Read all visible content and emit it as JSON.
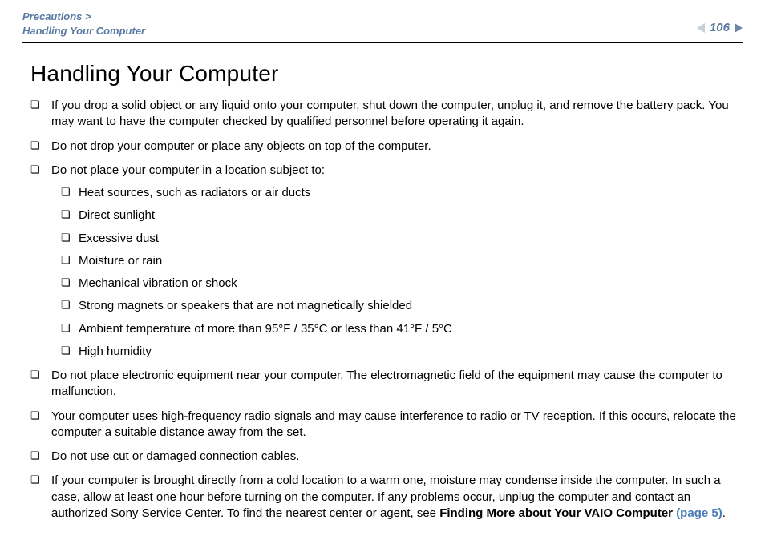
{
  "header": {
    "breadcrumb_section": "Precautions >",
    "breadcrumb_page": "Handling Your Computer",
    "page_number": "106"
  },
  "title": "Handling Your Computer",
  "items": [
    {
      "text": "If you drop a solid object or any liquid onto your computer, shut down the computer, unplug it, and remove the battery pack. You may want to have the computer checked by qualified personnel before operating it again."
    },
    {
      "text": "Do not drop your computer or place any objects on top of the computer."
    },
    {
      "text": "Do not place your computer in a location subject to:",
      "sub": [
        "Heat sources, such as radiators or air ducts",
        "Direct sunlight",
        "Excessive dust",
        "Moisture or rain",
        "Mechanical vibration or shock",
        "Strong magnets or speakers that are not magnetically shielded",
        "Ambient temperature of more than 95°F / 35°C or less than 41°F / 5°C",
        "High humidity"
      ]
    },
    {
      "text": "Do not place electronic equipment near your computer. The electromagnetic field of the equipment may cause the computer to malfunction."
    },
    {
      "text": "Your computer uses high-frequency radio signals and may cause interference to radio or TV reception. If this occurs, relocate the computer a suitable distance away from the set."
    },
    {
      "text": "Do not use cut or damaged connection cables."
    },
    {
      "text_pre": "If your computer is brought directly from a cold location to a warm one, moisture may condense inside the computer. In such a case, allow at least one hour before turning on the computer. If any problems occur, unplug the computer and contact an authorized Sony Service Center. To find the nearest center or agent, see ",
      "bold": "Finding More about Your VAIO Computer ",
      "link": "(page 5)",
      "text_post": "."
    }
  ]
}
